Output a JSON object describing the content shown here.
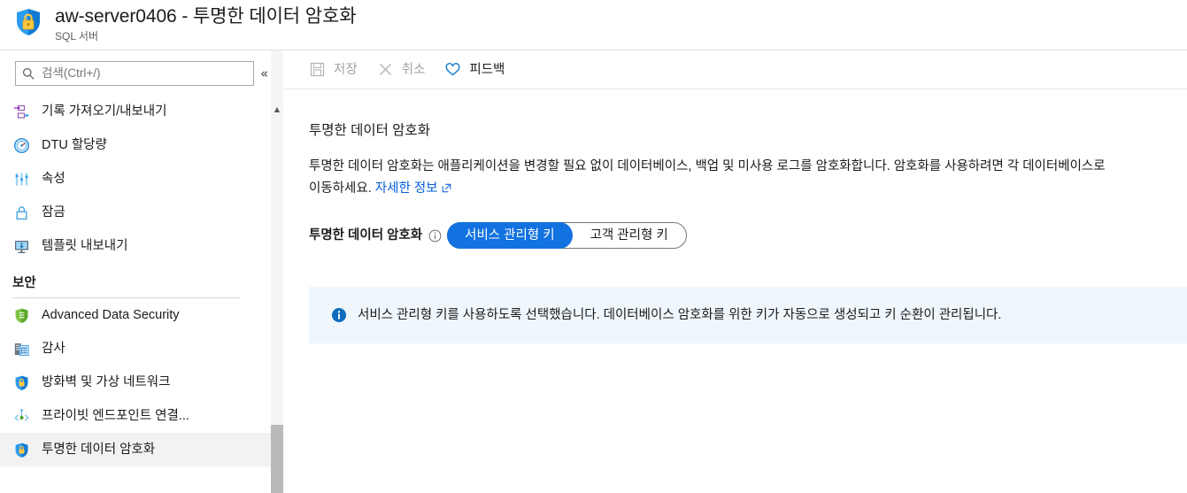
{
  "header": {
    "icon": "shield-lock-icon",
    "title": "aw-server0406 - 투명한 데이터 암호화",
    "subtitle": "SQL 서버"
  },
  "sidebar": {
    "search": {
      "placeholder": "검색(Ctrl+/)",
      "icon": "search-icon"
    },
    "collapse_label": "«",
    "items": [
      {
        "label": "기록 가져오기/내보내기",
        "icon": "import-export-icon",
        "selected": false
      },
      {
        "label": "DTU 할당량",
        "icon": "gauge-icon",
        "selected": false
      },
      {
        "label": "속성",
        "icon": "sliders-icon",
        "selected": false
      },
      {
        "label": "잠금",
        "icon": "lock-icon",
        "selected": false
      },
      {
        "label": "템플릿 내보내기",
        "icon": "export-template-icon",
        "selected": false
      }
    ],
    "section": {
      "title": "보안",
      "items": [
        {
          "label": "Advanced Data Security",
          "icon": "green-shield-icon",
          "selected": false
        },
        {
          "label": "감사",
          "icon": "audit-icon",
          "selected": false
        },
        {
          "label": "방화벽 및 가상 네트워크",
          "icon": "shield-lock-icon",
          "selected": false
        },
        {
          "label": "프라이빗 엔드포인트 연결...",
          "icon": "private-endpoint-icon",
          "selected": false
        },
        {
          "label": "투명한 데이터 암호화",
          "icon": "shield-lock-icon",
          "selected": true
        }
      ]
    }
  },
  "toolbar": {
    "save_label": "저장",
    "save_icon": "save-disk-icon",
    "cancel_label": "취소",
    "cancel_icon": "close-x-icon",
    "feedback_label": "피드백",
    "feedback_icon": "heart-icon"
  },
  "main": {
    "title": "투명한 데이터 암호화",
    "description_part1": "투명한 데이터 암호화는 애플리케이션을 변경할 필요 없이 데이터베이스, 백업 및 미사용 로그를 암호화합니다. 암호화를 사용하려면 각 데이터베이스로 이동하세요. ",
    "learn_more_label": "자세한 정보",
    "learn_more_icon": "external-link-icon",
    "toggle": {
      "label": "투명한 데이터 암호화",
      "info_icon": "info-circle-icon",
      "options": [
        {
          "label": "서비스 관리형 키",
          "selected": true
        },
        {
          "label": "고객 관리형 키",
          "selected": false
        }
      ]
    },
    "banner": {
      "icon": "info-filled-icon",
      "text": "서비스 관리형 키를 사용하도록 선택했습니다. 데이터베이스 암호화를 위한 키가 자동으로 생성되고 키 순환이 관리됩니다."
    }
  },
  "colors": {
    "accent_blue": "#1272e0",
    "link_blue": "#015cda",
    "banner_bg": "#eff6fc",
    "selected_nav_bg": "#f2f2f2"
  }
}
